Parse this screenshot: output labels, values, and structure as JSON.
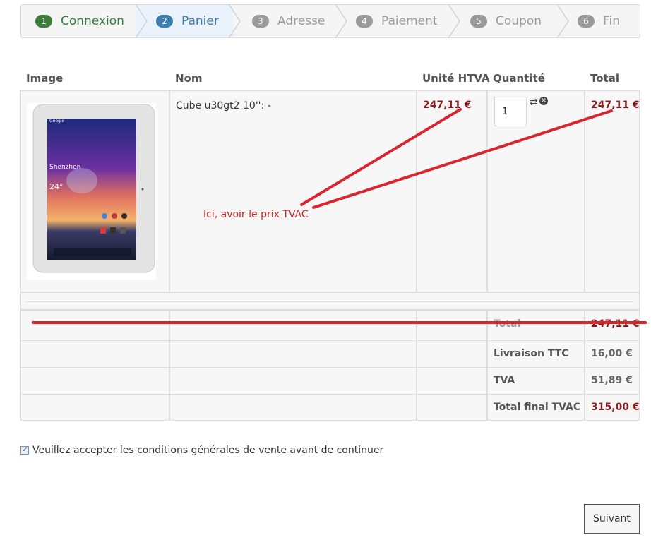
{
  "stepper": [
    {
      "num": "1",
      "label": "Connexion"
    },
    {
      "num": "2",
      "label": "Panier"
    },
    {
      "num": "3",
      "label": "Adresse"
    },
    {
      "num": "4",
      "label": "Paiement"
    },
    {
      "num": "5",
      "label": "Coupon"
    },
    {
      "num": "6",
      "label": "Fin"
    }
  ],
  "table": {
    "headers": {
      "image": "Image",
      "name": "Nom",
      "unit_price": "Unité HTVA",
      "quantity": "Quantité",
      "total": "Total"
    },
    "product": {
      "name": "Cube u30gt2 10'': -",
      "unit_price": "247,11 €",
      "quantity": "1",
      "total": "247,11 €",
      "screen_city": "Shenzhen",
      "screen_temp": "24°",
      "screen_brand": "Google"
    },
    "summary": [
      {
        "label": "Total",
        "value": "247,11 €"
      },
      {
        "label": "Livraison TTC",
        "value": "16,00 €"
      },
      {
        "label": "TVA",
        "value": "51,89 €"
      },
      {
        "label": "Total final TVAC",
        "value": "315,00 €"
      }
    ]
  },
  "annotation": "Ici, avoir le prix TVAC",
  "terms": "Veuillez accepter les conditions générales de vente avant de continuer",
  "next_button": "Suivant",
  "colors": {
    "annotation_red": "#d9262e",
    "price_red": "#8b1a1a",
    "step_done": "#3c7d3c",
    "step_active": "#3a7fad"
  }
}
